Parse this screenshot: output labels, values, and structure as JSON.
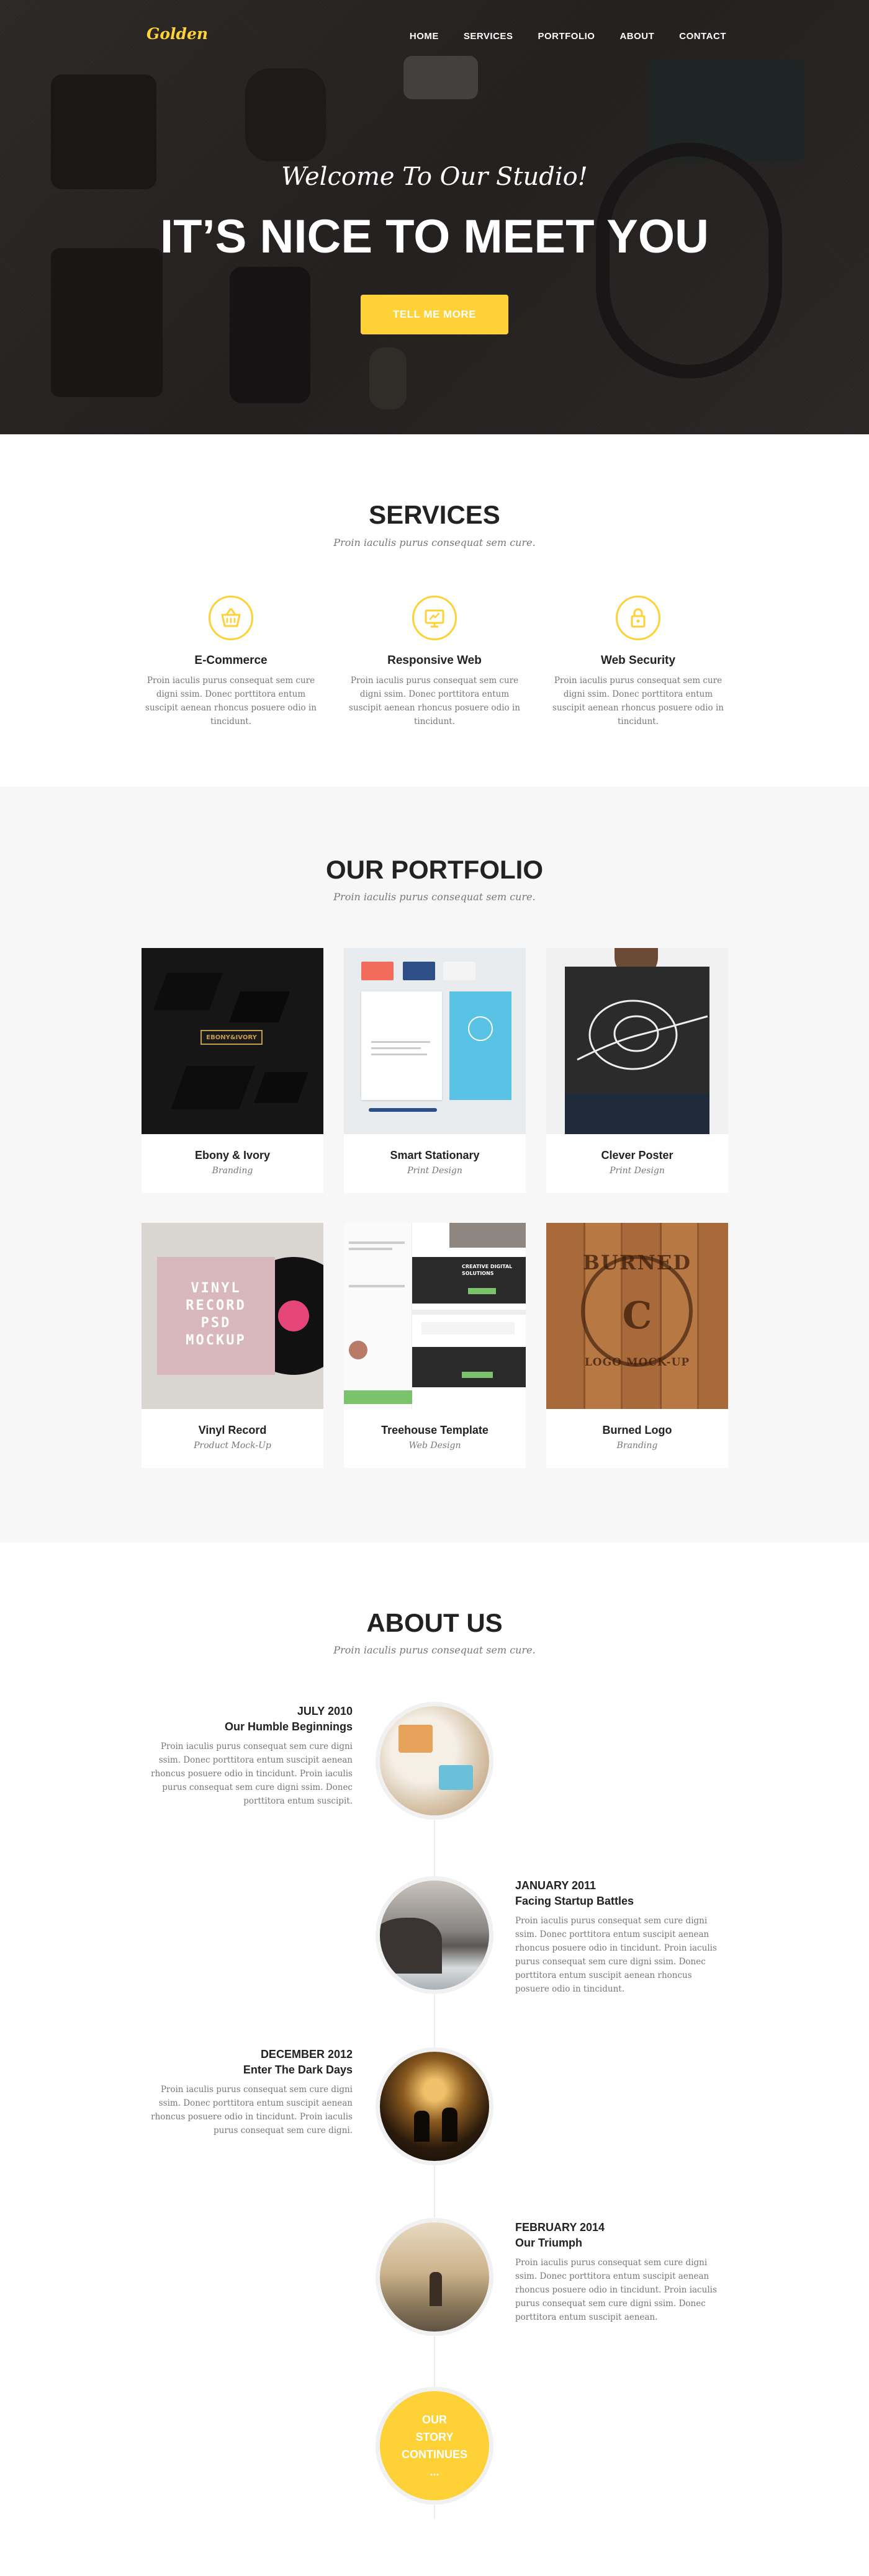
{
  "brand": {
    "logo": "Golden",
    "accent": "#fed136"
  },
  "nav": {
    "items": [
      "HOME",
      "SERVICES",
      "PORTFOLIO",
      "ABOUT",
      "CONTACT"
    ]
  },
  "hero": {
    "subtitle": "Welcome To Our Studio!",
    "title": "IT’S NICE TO MEET YOU",
    "button": "TELL ME MORE"
  },
  "services": {
    "title": "SERVICES",
    "subtitle": "Proin iaculis purus consequat sem cure.",
    "items": [
      {
        "icon": "shopping-basket-icon",
        "title": "E-Commerce",
        "text": "Proin iaculis purus consequat sem cure digni ssim. Donec porttitora entum suscipit aenean rhoncus posuere odio in tincidunt."
      },
      {
        "icon": "monitor-icon",
        "title": "Responsive Web",
        "text": "Proin iaculis purus consequat sem cure digni ssim. Donec porttitora entum suscipit aenean rhoncus posuere odio in tincidunt."
      },
      {
        "icon": "lock-icon",
        "title": "Web Security",
        "text": "Proin iaculis purus consequat sem cure digni ssim. Donec porttitora entum suscipit aenean rhoncus posuere odio in tincidunt."
      }
    ]
  },
  "portfolio": {
    "title": "OUR PORTFOLIO",
    "subtitle": "Proin iaculis purus consequat sem cure.",
    "items": [
      {
        "name": "Ebony & Ivory",
        "category": "Branding",
        "image_text": "EBONY&IVORY"
      },
      {
        "name": "Smart Stationary",
        "category": "Print Design"
      },
      {
        "name": "Clever Poster",
        "category": "Print Design"
      },
      {
        "name": "Vinyl Record",
        "category": "Product Mock-Up",
        "image_text": [
          "VINYL",
          "RECORD",
          "PSD",
          "MOCKUP"
        ]
      },
      {
        "name": "Treehouse Template",
        "category": "Web Design",
        "image_text": "CREATIVE DIGITAL SOLUTIONS"
      },
      {
        "name": "Burned Logo",
        "category": "Branding",
        "image_text": [
          "BURNED",
          "C",
          "LOGO MOCK-UP"
        ]
      }
    ]
  },
  "about": {
    "title": "ABOUT US",
    "subtitle": "Proin iaculis purus consequat sem cure.",
    "timeline": [
      {
        "date": "JULY 2010",
        "heading": "Our Humble Beginnings",
        "text": "Proin iaculis purus consequat sem cure digni ssim. Donec porttitora entum suscipit aenean rhoncus posuere odio in tincidunt. Proin iaculis purus consequat sem cure digni ssim. Donec porttitora entum suscipit."
      },
      {
        "date": "JANUARY 2011",
        "heading": "Facing Startup Battles",
        "text": "Proin iaculis purus consequat sem cure digni ssim. Donec porttitora entum suscipit aenean rhoncus posuere odio in tincidunt. Proin iaculis purus consequat sem cure digni ssim. Donec porttitora entum suscipit aenean rhoncus posuere odio in tincidunt."
      },
      {
        "date": "DECEMBER 2012",
        "heading": "Enter The Dark Days",
        "text": "Proin iaculis purus consequat sem cure digni ssim. Donec porttitora entum suscipit aenean rhoncus posuere odio in tincidunt. Proin iaculis purus consequat sem cure digni."
      },
      {
        "date": "FEBRUARY 2014",
        "heading": "Our Triumph",
        "text": "Proin iaculis purus consequat sem cure digni ssim. Donec porttitora entum suscipit aenean rhoncus posuere odio in tincidunt. Proin iaculis purus consequat sem cure digni ssim. Donec porttitora entum suscipit aenean."
      }
    ],
    "end": {
      "line1": "OUR",
      "line2": "STORY",
      "line3": "CONTINUES",
      "line4": "..."
    }
  }
}
